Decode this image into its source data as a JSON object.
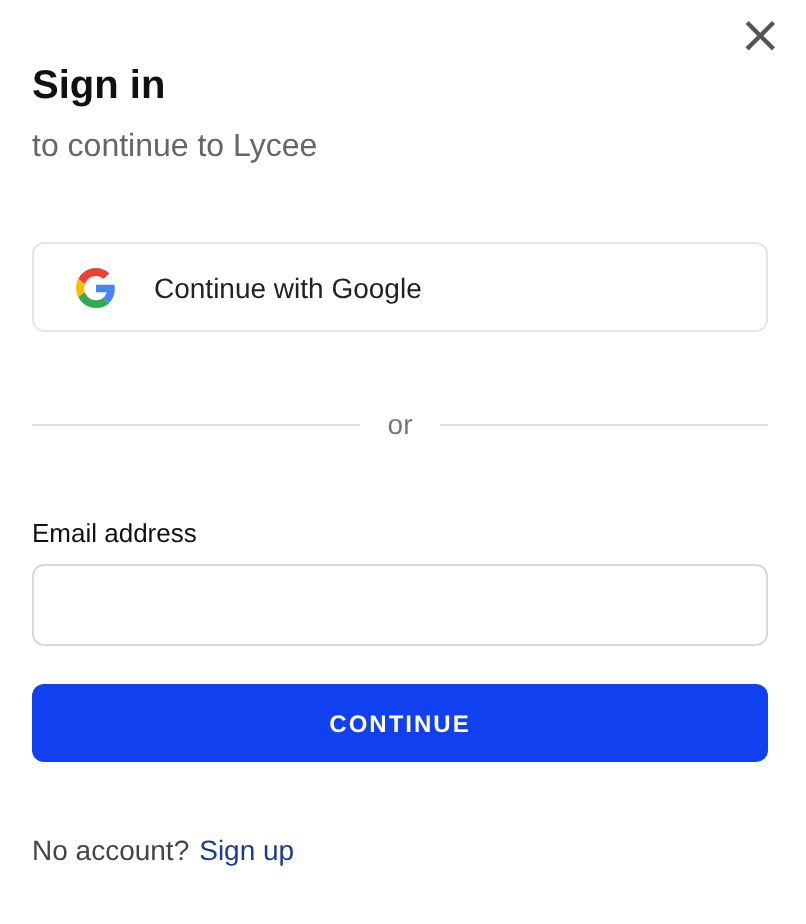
{
  "dialog": {
    "close": "×",
    "title": "Sign in",
    "subtitle": "to continue to Lycee"
  },
  "social_button": {
    "label": "Continue with Google"
  },
  "divider": {
    "text": "or"
  },
  "email": {
    "label": "Email address"
  },
  "submit": {
    "label": "CONTINUE"
  },
  "footer": {
    "text": "No account?",
    "link": "Sign up"
  }
}
